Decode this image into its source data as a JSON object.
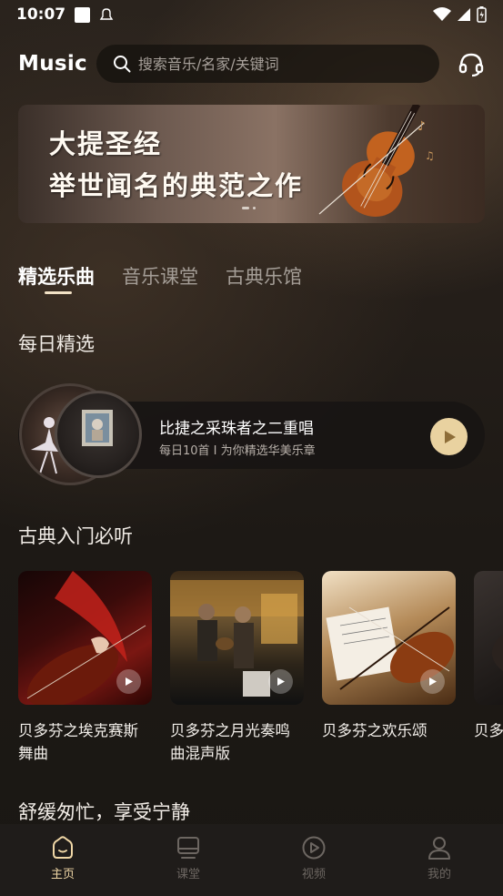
{
  "status_bar": {
    "time": "10:07"
  },
  "header": {
    "logo": "Music",
    "search_placeholder": "搜索音乐/名家/关键词"
  },
  "banner": {
    "line1": "大提圣经",
    "line2": "举世闻名的典范之作"
  },
  "tabs": [
    {
      "label": "精选乐曲",
      "active": true
    },
    {
      "label": "音乐课堂",
      "active": false
    },
    {
      "label": "古典乐馆",
      "active": false
    }
  ],
  "daily": {
    "section_title": "每日精选",
    "title": "比捷之采珠者之二重唱",
    "subtitle": "每日10首 I 为你精选华美乐章"
  },
  "classics": {
    "section_title": "古典入门必听",
    "items": [
      {
        "name": "贝多芬之埃克赛斯舞曲"
      },
      {
        "name": "贝多芬之月光奏鸣曲混声版"
      },
      {
        "name": "贝多芬之欢乐颂"
      },
      {
        "name": "贝多芬之…乐第…"
      }
    ]
  },
  "section3_title": "舒缓匆忙，享受宁静",
  "bottom_nav": [
    {
      "label": "主页",
      "icon": "home-icon",
      "active": true
    },
    {
      "label": "课堂",
      "icon": "classroom-icon",
      "active": false
    },
    {
      "label": "视频",
      "icon": "video-icon",
      "active": false
    },
    {
      "label": "我的",
      "icon": "profile-icon",
      "active": false
    }
  ],
  "colors": {
    "accent": "#e9d2a0",
    "active_nav": "#f0d7a6",
    "background": "#1b1714"
  }
}
